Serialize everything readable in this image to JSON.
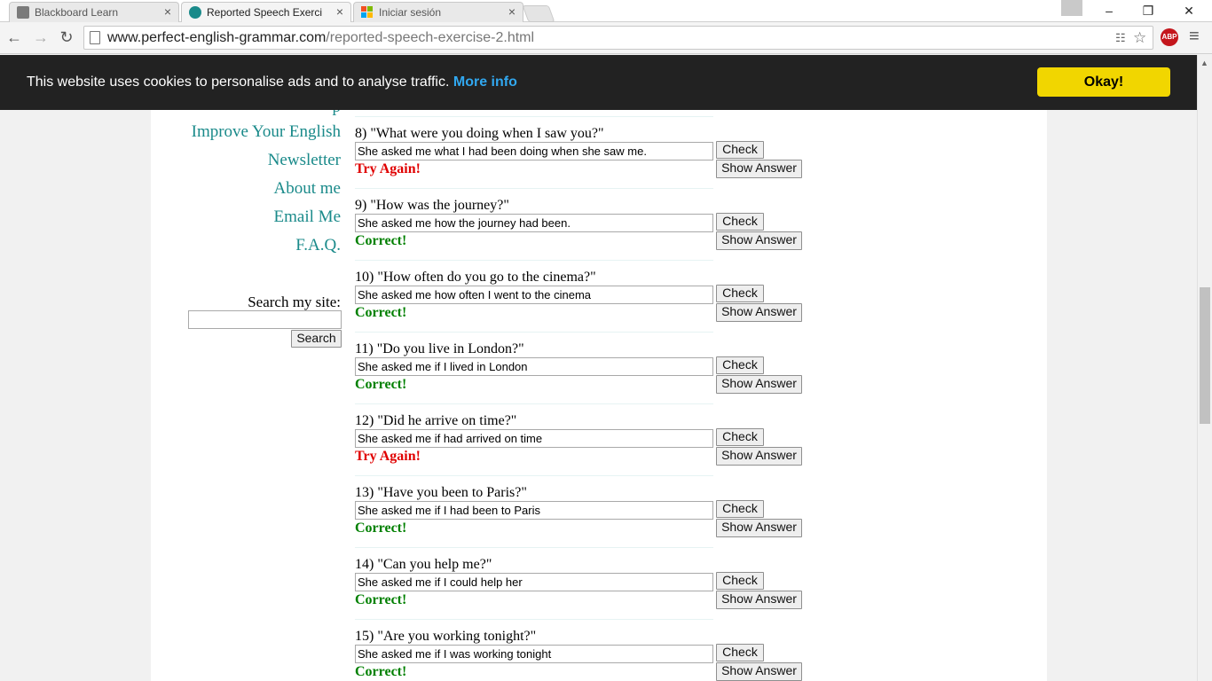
{
  "browser": {
    "tabs": [
      {
        "title": "Blackboard Learn",
        "icon": "blackboard-icon",
        "active": false
      },
      {
        "title": "Reported Speech Exercise",
        "icon": "pg-icon",
        "active": true
      },
      {
        "title": "Iniciar sesión",
        "icon": "microsoft-icon",
        "active": false
      }
    ],
    "url_host": "www.perfect-english-grammar.com",
    "url_path": "/reported-speech-exercise-2.html",
    "abp_label": "ABP"
  },
  "cookie": {
    "text": "This website uses cookies to personalise ads and to analyse traffic.",
    "link": "More info",
    "button": "Okay!"
  },
  "sidebar": {
    "links": [
      "Improve Your English",
      "Newsletter",
      "About me",
      "Email Me",
      "F.A.Q."
    ],
    "search_label": "Search my site:",
    "search_button": "Search"
  },
  "colors": {
    "link": "#1a8a8a",
    "correct": "#008000",
    "try_again": "#e00000",
    "cookie_bg": "#222222",
    "okay_bg": "#f1d600"
  },
  "exercise": {
    "check_label": "Check",
    "show_label": "Show Answer",
    "questions": [
      {
        "prompt": "8) \"What were you doing when I saw you?\"",
        "answer": "She asked me what I had been doing when she saw me.",
        "result": "Try Again!",
        "status": "wrong"
      },
      {
        "prompt": "9) \"How was the journey?\"",
        "answer": "She asked me how the journey had been.",
        "result": "Correct!",
        "status": "correct"
      },
      {
        "prompt": "10) \"How often do you go to the cinema?\"",
        "answer": "She asked me how often I went to the cinema",
        "result": "Correct!",
        "status": "correct"
      },
      {
        "prompt": "11) \"Do you live in London?\"",
        "answer": "She asked me if I lived in London",
        "result": "Correct!",
        "status": "correct"
      },
      {
        "prompt": "12) \"Did he arrive on time?\"",
        "answer": "She asked me if had arrived on time",
        "result": "Try Again!",
        "status": "wrong"
      },
      {
        "prompt": "13) \"Have you been to Paris?\"",
        "answer": "She asked me if I had been to Paris",
        "result": "Correct!",
        "status": "correct"
      },
      {
        "prompt": "14) \"Can you help me?\"",
        "answer": "She asked me if I could help her",
        "result": "Correct!",
        "status": "correct"
      },
      {
        "prompt": "15) \"Are you working tonight?\"",
        "answer": "She asked me if I was working tonight",
        "result": "Correct!",
        "status": "correct"
      }
    ]
  }
}
